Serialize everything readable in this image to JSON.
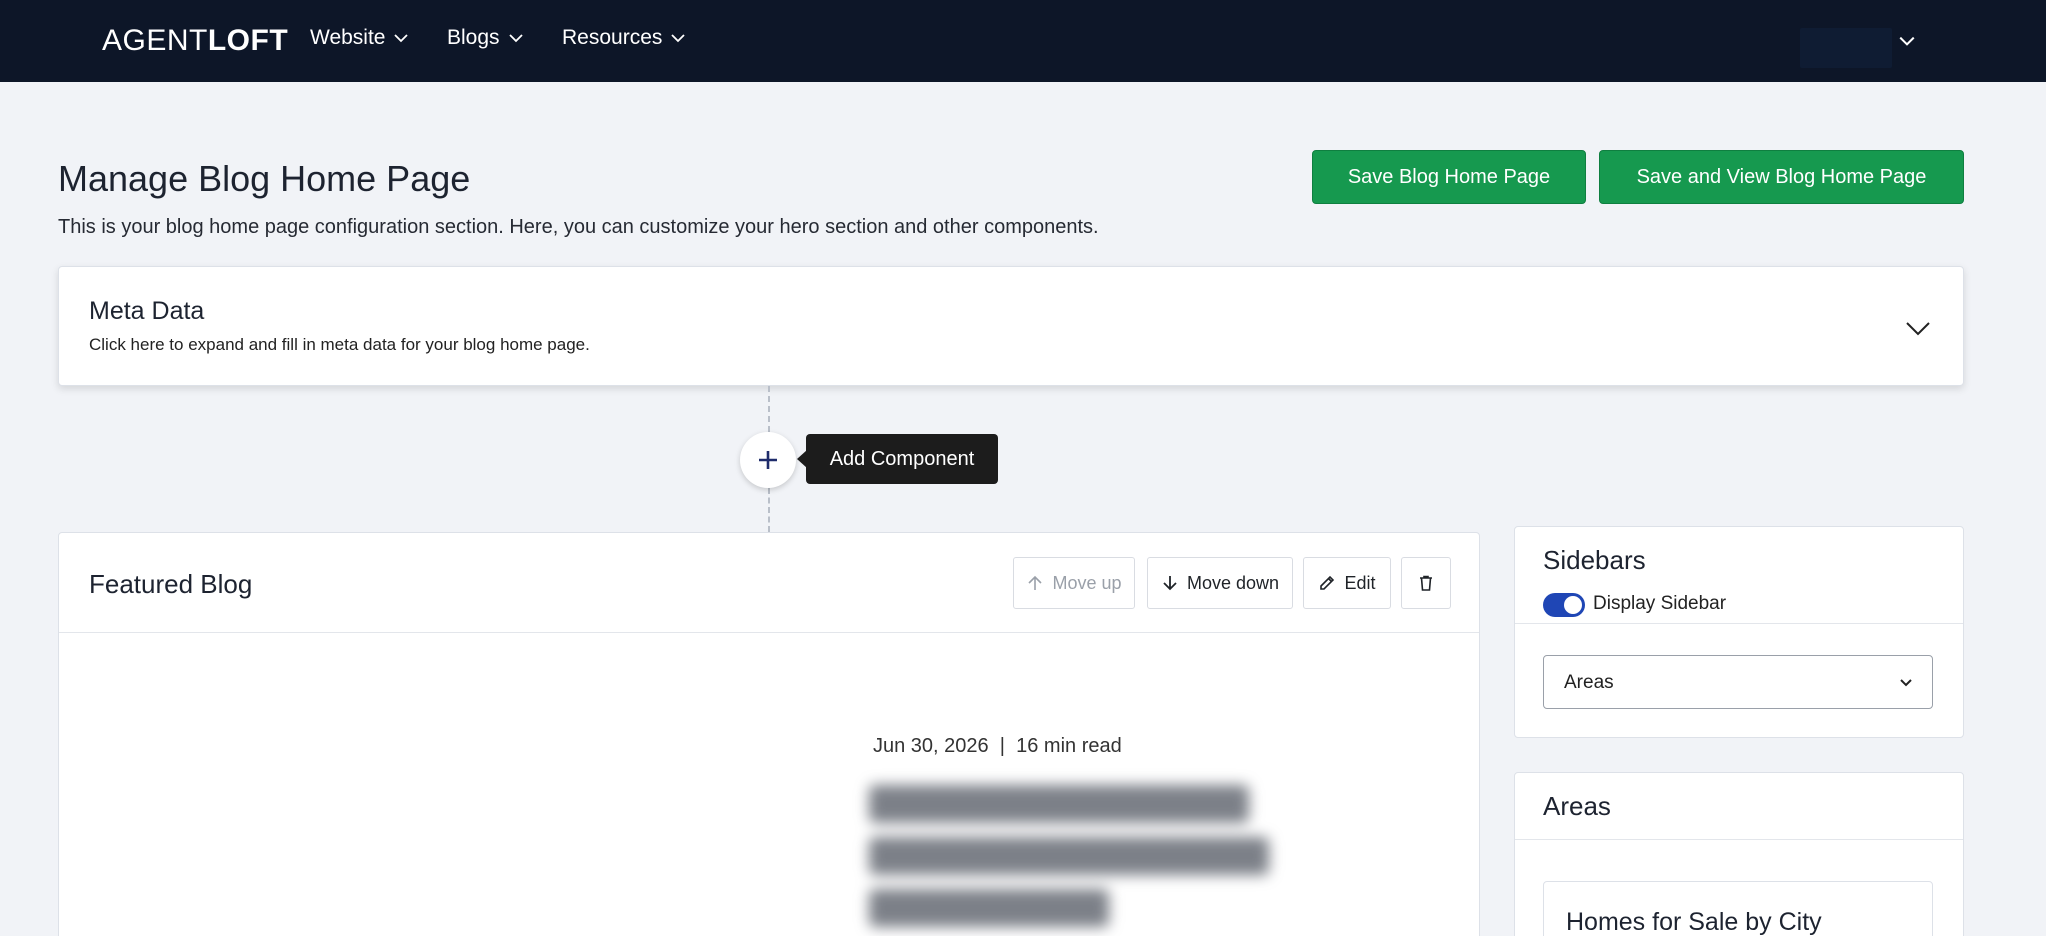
{
  "nav": {
    "logo_light": "AGENT",
    "logo_bold": "LOFT",
    "items": [
      {
        "label": "Website"
      },
      {
        "label": "Blogs"
      },
      {
        "label": "Resources"
      }
    ]
  },
  "header": {
    "title": "Manage Blog Home Page",
    "description": "This is your blog home page configuration section. Here, you can customize your hero section and other components.",
    "save_label": "Save Blog Home Page",
    "save_view_label": "Save and View Blog Home Page"
  },
  "meta": {
    "title": "Meta Data",
    "subtitle": "Click here to expand and fill in meta data for your blog home page."
  },
  "add_component": {
    "tooltip": "Add Component"
  },
  "featured": {
    "title": "Featured Blog",
    "move_up": "Move up",
    "move_down": "Move down",
    "edit": "Edit",
    "date": "Jun 30, 2026",
    "separator": "|",
    "read_time": "16 min read"
  },
  "sidebars": {
    "title": "Sidebars",
    "toggle_label": "Display Sidebar",
    "toggle_on": true,
    "select_value": "Areas"
  },
  "areas": {
    "title": "Areas",
    "inner_title": "Homes for Sale by City"
  },
  "colors": {
    "nav_bg": "#0d1628",
    "primary_green": "#16994f",
    "toggle_blue": "#1f46b5",
    "page_bg": "#f1f3f7"
  }
}
